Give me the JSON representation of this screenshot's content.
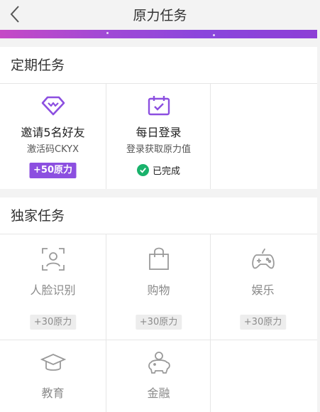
{
  "nav": {
    "title": "原力任务"
  },
  "colors": {
    "accent": "#8c4fe0",
    "success": "#19b26b",
    "muted": "#8a8a8a"
  },
  "regular": {
    "header": "定期任务",
    "tasks": [
      {
        "icon": "diamond-icon",
        "title": "邀请5名好友",
        "subtitle": "激活码CKYX",
        "badge": "+50原力"
      },
      {
        "icon": "calendar-check-icon",
        "title": "每日登录",
        "subtitle": "登录获取原力值",
        "status": "已完成"
      }
    ]
  },
  "exclusive": {
    "header": "独家任务",
    "tasks": [
      {
        "icon": "face-scan-icon",
        "label": "人脸识别",
        "badge": "+30原力"
      },
      {
        "icon": "shopping-bag-icon",
        "label": "购物",
        "badge": "+30原力"
      },
      {
        "icon": "gamepad-icon",
        "label": "娱乐",
        "badge": "+30原力"
      },
      {
        "icon": "graduation-cap-icon",
        "label": "教育"
      },
      {
        "icon": "piggy-bank-icon",
        "label": "金融"
      }
    ]
  }
}
